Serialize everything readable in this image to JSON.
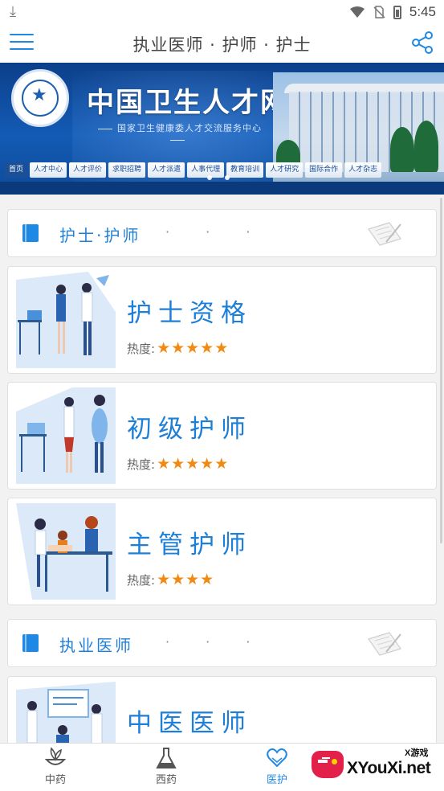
{
  "status_bar": {
    "time": "5:45",
    "icons": [
      "download-icon",
      "wifi-icon",
      "no-sim-icon",
      "battery-icon"
    ]
  },
  "app_bar": {
    "title": "执业医师 · 护师 · 护士",
    "menu_icon": "hamburger-menu-icon",
    "share_icon": "share-icon"
  },
  "banner": {
    "site_title": "中国卫生人才网",
    "site_subtitle": "国家卫生健康委人才交流服务中心",
    "emblem_text": "国家卫生健康委人才交流服务中心",
    "nav_tabs": [
      "首页",
      "人才中心",
      "人才评价",
      "求职招聘",
      "人才派遣",
      "人事代理",
      "教育培训",
      "人才研究",
      "国际合作",
      "人才杂志"
    ],
    "active_tab": 0,
    "slide_count": 2
  },
  "sections": [
    {
      "title": "护士·护师",
      "dots": "· · ·",
      "icon": "book-icon",
      "cards": [
        {
          "title": "护士资格",
          "heat_label": "热度:",
          "stars": "★★★★★",
          "rating": 5,
          "illustration": "nurses-meeting-illustration"
        },
        {
          "title": "初级护师",
          "heat_label": "热度:",
          "stars": "★★★★★",
          "rating": 5,
          "illustration": "nurses-standing-illustration"
        },
        {
          "title": "主管护师",
          "heat_label": "热度:",
          "stars": "★★★★",
          "rating": 4,
          "illustration": "nurses-desk-illustration"
        }
      ]
    },
    {
      "title": "执业医师",
      "dots": "· · ·",
      "icon": "book-icon",
      "cards": [
        {
          "title": "中医医师",
          "illustration": "doctors-presentation-illustration"
        }
      ]
    }
  ],
  "bottom_nav": {
    "items": [
      {
        "label": "中药",
        "icon": "herb-icon",
        "active": false
      },
      {
        "label": "西药",
        "icon": "flask-icon",
        "active": false
      },
      {
        "label": "医护",
        "icon": "heart-hands-icon",
        "active": true
      }
    ]
  },
  "watermark": {
    "brand": "XYouXi.net",
    "tag": "X游戏"
  },
  "colors": {
    "accent": "#1e88e5",
    "title_blue": "#1e7fd8",
    "star_orange": "#f08a12",
    "banner_blue": "#135bb5"
  }
}
